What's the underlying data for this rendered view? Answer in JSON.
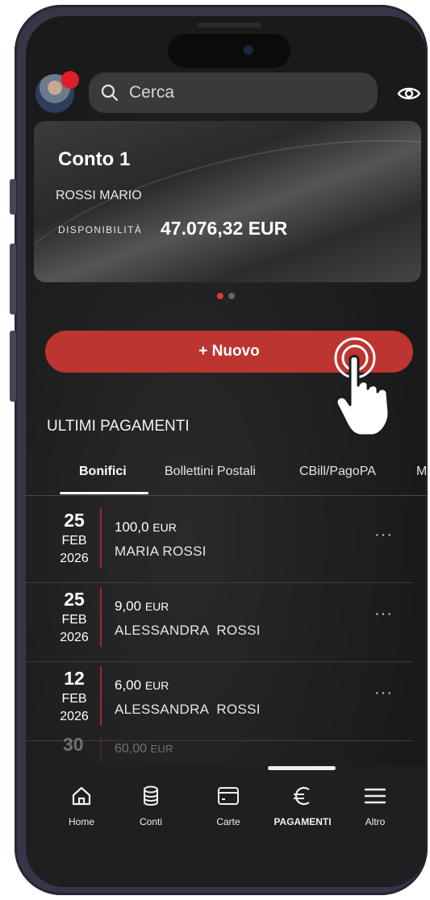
{
  "search": {
    "placeholder": "Cerca"
  },
  "account_card": {
    "title": "Conto 1",
    "holder": "ROSSI MARIO",
    "availability_label": "DISPONIBILITÀ",
    "availability_value": "47.076,32 EUR"
  },
  "carousel": {
    "pages": 2,
    "active_index": 0
  },
  "new_button": {
    "label": "+ Nuovo"
  },
  "section_title": "ULTIMI PAGAMENTI",
  "tabs": [
    {
      "label": "Bonifici",
      "active": true
    },
    {
      "label": "Bollettini Postali",
      "active": false
    },
    {
      "label": "CBill/PagoPA",
      "active": false
    },
    {
      "label": "M",
      "active": false
    }
  ],
  "payments": [
    {
      "day": "25",
      "month": "FEB",
      "year": "2026",
      "amount": "100,0",
      "currency": "EUR",
      "name": "MARIA ROSSI",
      "more": "···"
    },
    {
      "day": "25",
      "month": "FEB",
      "year": "2026",
      "amount": "9,00",
      "currency": "EUR",
      "name": "ALESSANDRA  ROSSI",
      "more": "···"
    },
    {
      "day": "12",
      "month": "FEB",
      "year": "2026",
      "amount": "6,00",
      "currency": "EUR",
      "name": "ALESSANDRA  ROSSI",
      "more": "···"
    }
  ],
  "partial_payment": {
    "day": "30",
    "amount": "60,00",
    "currency": "EUR"
  },
  "nav": {
    "items": [
      {
        "label": "Home",
        "icon": "home-icon"
      },
      {
        "label": "Conti",
        "icon": "coins-stack-icon"
      },
      {
        "label": "Carte",
        "icon": "card-icon"
      },
      {
        "label": "PAGAMENTI",
        "icon": "euro-icon",
        "active": true
      },
      {
        "label": "Altro",
        "icon": "menu-icon"
      }
    ]
  },
  "colors": {
    "accent": "#bd3530",
    "background": "#1b1b1d",
    "notification": "#e01e2b"
  }
}
